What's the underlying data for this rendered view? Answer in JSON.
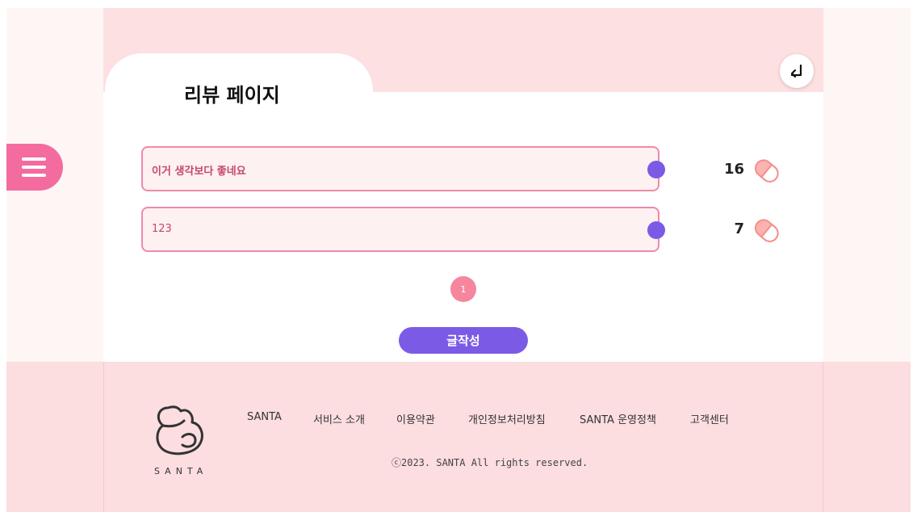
{
  "header": {
    "title": "리뷰 페이지"
  },
  "nav": {
    "menu_icon": "hamburger-menu-icon",
    "back_icon": "return-arrow-icon"
  },
  "reviews": [
    {
      "text": "이거 생각보다 좋네요",
      "likes": "16"
    },
    {
      "text": "123",
      "likes": "7"
    }
  ],
  "pagination": {
    "current": "1"
  },
  "actions": {
    "write_label": "글작성"
  },
  "footer": {
    "logo_text": "SANTA",
    "links": [
      "SANTA",
      "서비스 소개",
      "이용약관",
      "개인정보처리방침",
      "SANTA 운영정책",
      "고객센터"
    ],
    "copyright": "ⓒ2023. SANTA All rights reserved."
  },
  "colors": {
    "accent_purple": "#7b5be6",
    "accent_pink": "#f46ba0",
    "background_pink": "#fde0e1",
    "review_border": "#f08aa8"
  }
}
